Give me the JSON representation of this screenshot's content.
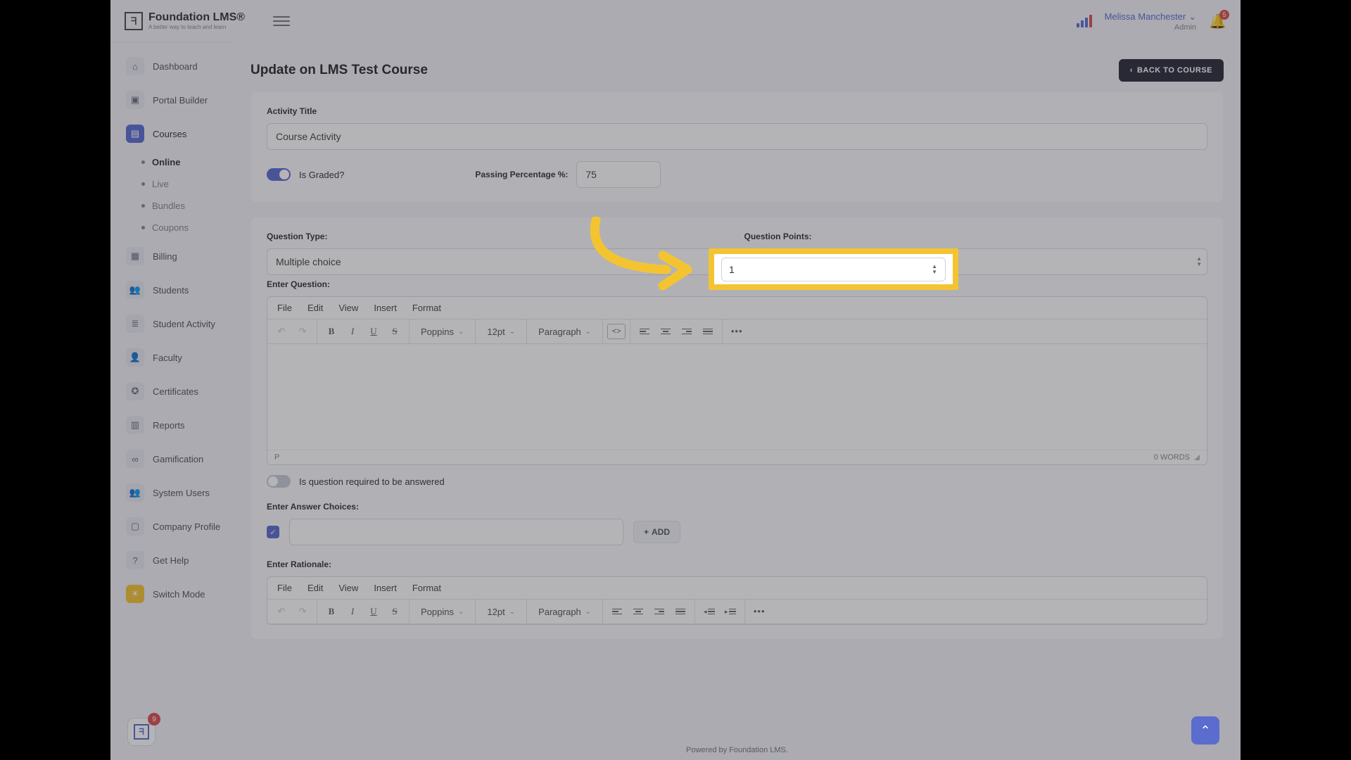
{
  "brand": {
    "title": "Foundation LMS®",
    "subtitle": "A better way to teach and learn"
  },
  "user": {
    "name": "Melissa Manchester",
    "role": "Admin",
    "notifications": "5"
  },
  "sidebar": {
    "items": [
      {
        "label": "Dashboard",
        "icon": "home"
      },
      {
        "label": "Portal Builder",
        "icon": "portal"
      },
      {
        "label": "Courses",
        "icon": "courses",
        "active": true
      },
      {
        "label": "Billing",
        "icon": "billing"
      },
      {
        "label": "Students",
        "icon": "students"
      },
      {
        "label": "Student Activity",
        "icon": "activity"
      },
      {
        "label": "Faculty",
        "icon": "faculty"
      },
      {
        "label": "Certificates",
        "icon": "cert"
      },
      {
        "label": "Reports",
        "icon": "reports"
      },
      {
        "label": "Gamification",
        "icon": "game"
      },
      {
        "label": "System Users",
        "icon": "sysusers"
      },
      {
        "label": "Company Profile",
        "icon": "company"
      },
      {
        "label": "Get Help",
        "icon": "help"
      },
      {
        "label": "Switch Mode",
        "icon": "switch"
      }
    ],
    "sub_items": [
      {
        "label": "Online",
        "active": true
      },
      {
        "label": "Live"
      },
      {
        "label": "Bundles"
      },
      {
        "label": "Coupons"
      }
    ],
    "badge_count": "9"
  },
  "page": {
    "title": "Update on LMS Test Course",
    "back_label": "BACK TO COURSE"
  },
  "activity": {
    "title_label": "Activity Title",
    "title_value": "Course Activity",
    "graded_label": "Is Graded?",
    "passing_label": "Passing Percentage %:",
    "passing_value": "75"
  },
  "question": {
    "type_label": "Question Type:",
    "type_value": "Multiple choice",
    "points_label": "Question Points:",
    "points_value": "1",
    "enter_label": "Enter Question:",
    "required_label": "Is question required to be answered",
    "answers_label": "Enter Answer Choices:",
    "add_label": "ADD",
    "rationale_label": "Enter Rationale:"
  },
  "editor": {
    "menus": [
      "File",
      "Edit",
      "View",
      "Insert",
      "Format"
    ],
    "font": "Poppins",
    "size": "12pt",
    "block": "Paragraph",
    "status_path": "P",
    "word_count": "0 WORDS"
  },
  "footer": "Powered by Foundation LMS."
}
